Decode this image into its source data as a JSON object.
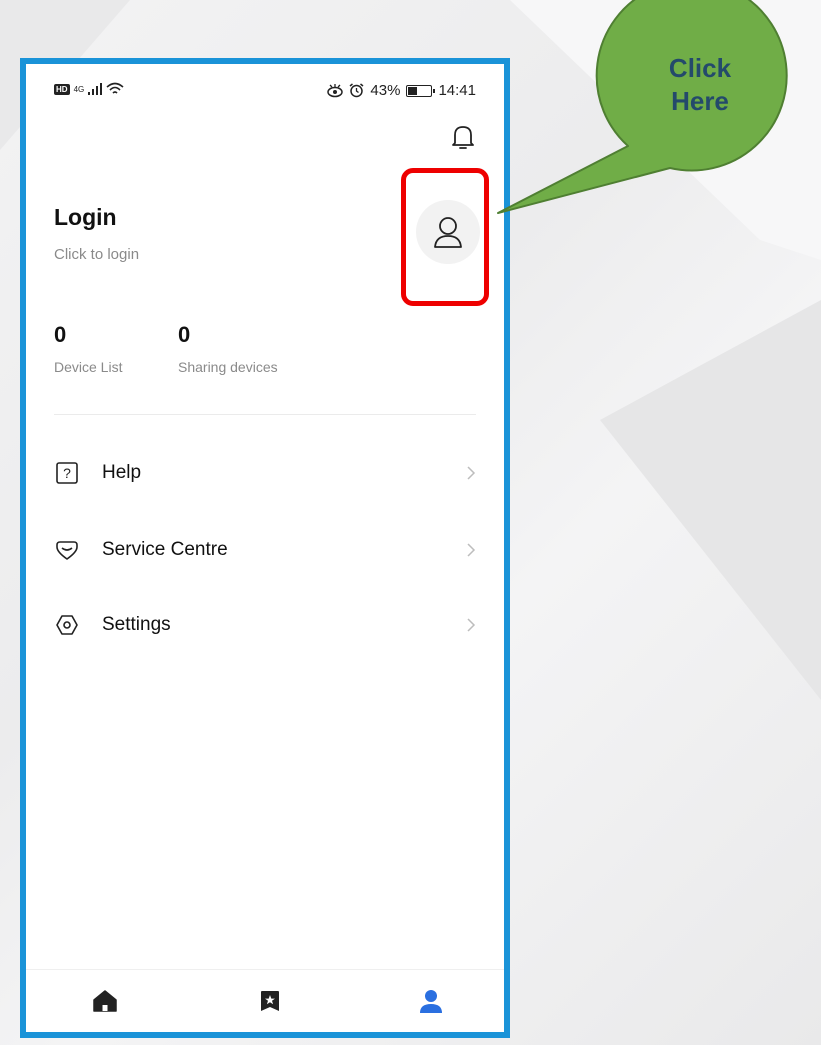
{
  "colors": {
    "frame_border": "#1a93d8",
    "highlight_border": "#ee0000",
    "callout_fill": "#70ad47",
    "callout_border": "#4f7f32",
    "callout_text": "#244a6b",
    "active_tab": "#2a6fe0"
  },
  "statusbar": {
    "network": "4G",
    "battery": "43%",
    "battery_level": 0.43,
    "time": "14:41",
    "icons": [
      "hd-icon",
      "signal-icon",
      "wifi-icon",
      "eye-icon",
      "alarm-icon",
      "battery-icon"
    ]
  },
  "header": {
    "notification_icon": "bell-icon"
  },
  "profile": {
    "title": "Login",
    "subtitle": "Click to login",
    "avatar_icon": "user-icon"
  },
  "stats": [
    {
      "value": "0",
      "label": "Device List"
    },
    {
      "value": "0",
      "label": "Sharing devices"
    }
  ],
  "menu": [
    {
      "label": "Help",
      "icon": "help-icon"
    },
    {
      "label": "Service Centre",
      "icon": "service-icon"
    },
    {
      "label": "Settings",
      "icon": "settings-icon"
    }
  ],
  "tabbar": {
    "tabs": [
      {
        "icon": "home-icon",
        "active": false
      },
      {
        "icon": "scene-icon",
        "active": false
      },
      {
        "icon": "profile-icon",
        "active": true
      }
    ]
  },
  "callout": {
    "line1": "Click",
    "line2": "Here"
  }
}
